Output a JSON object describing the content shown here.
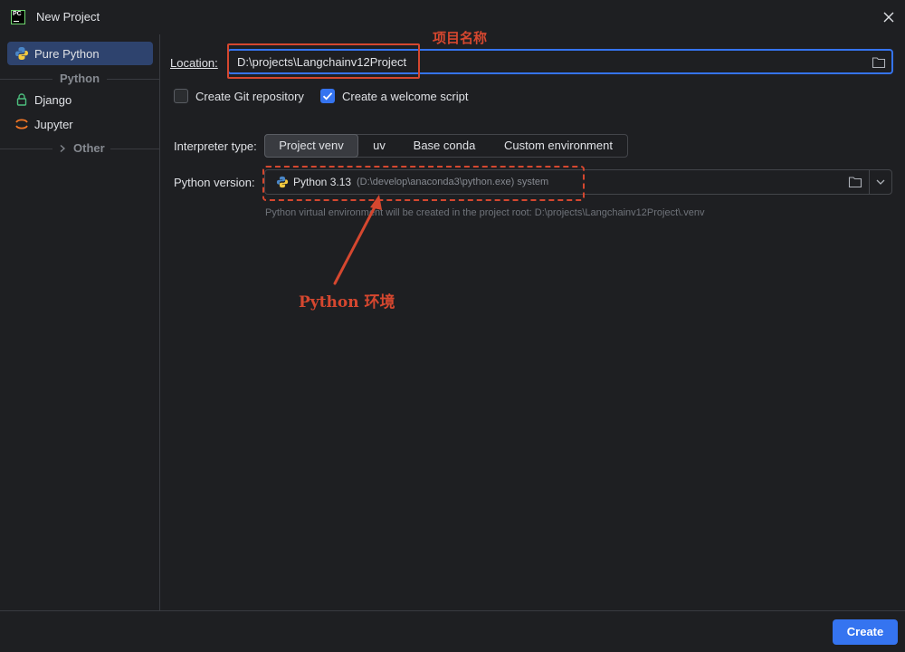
{
  "window": {
    "title": "New Project",
    "app_icon_text": "PC"
  },
  "sidebar": {
    "items": [
      {
        "label": "Pure Python",
        "icon": "python-icon",
        "selected": true
      },
      {
        "label": "Django",
        "icon": "lock-icon",
        "selected": false
      },
      {
        "label": "Jupyter",
        "icon": "jupyter-icon",
        "selected": false
      }
    ],
    "group_python": "Python",
    "group_other": "Other"
  },
  "form": {
    "location_label": "Location:",
    "location_value": "D:\\projects\\Langchainv12Project",
    "create_git_label": "Create Git repository",
    "create_git_checked": false,
    "welcome_script_label": "Create a welcome script",
    "welcome_script_checked": true,
    "interpreter_label": "Interpreter type:",
    "interpreter_options": [
      "Project venv",
      "uv",
      "Base conda",
      "Custom environment"
    ],
    "interpreter_selected": "Project venv",
    "python_version_label": "Python version:",
    "python_version_name": "Python 3.13",
    "python_version_path": "(D:\\develop\\anaconda3\\python.exe) system",
    "hint": "Python virtual environment will be created in the project root: D:\\projects\\Langchainv12Project\\.venv"
  },
  "annotations": {
    "project_name": "项目名称",
    "python_env": "Python 环境"
  },
  "footer": {
    "create_label": "Create"
  },
  "colors": {
    "background": "#1e1f22",
    "accent": "#3574f0",
    "annotation": "#d5472f",
    "selected": "#2e436e"
  }
}
